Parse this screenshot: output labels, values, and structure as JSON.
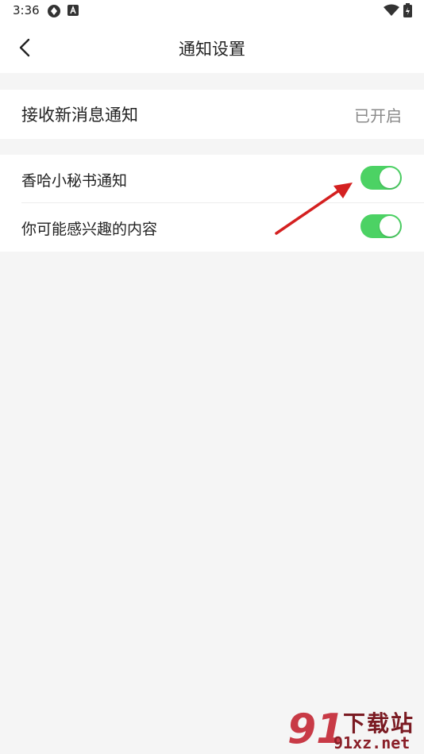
{
  "status_bar": {
    "time": "3:36"
  },
  "header": {
    "title": "通知设置",
    "back_icon": "chevron-left-icon"
  },
  "receive_row": {
    "label": "接收新消息通知",
    "value": "已开启"
  },
  "settings": [
    {
      "label": "香哈小秘书通知",
      "enabled": true
    },
    {
      "label": "你可能感兴趣的内容",
      "enabled": true
    }
  ],
  "watermark": {
    "logo": "91",
    "title": "下载站",
    "domain": "91xz.net"
  },
  "colors": {
    "toggle_on": "#4cd264",
    "arrow": "#d42020",
    "background": "#f5f5f5"
  }
}
